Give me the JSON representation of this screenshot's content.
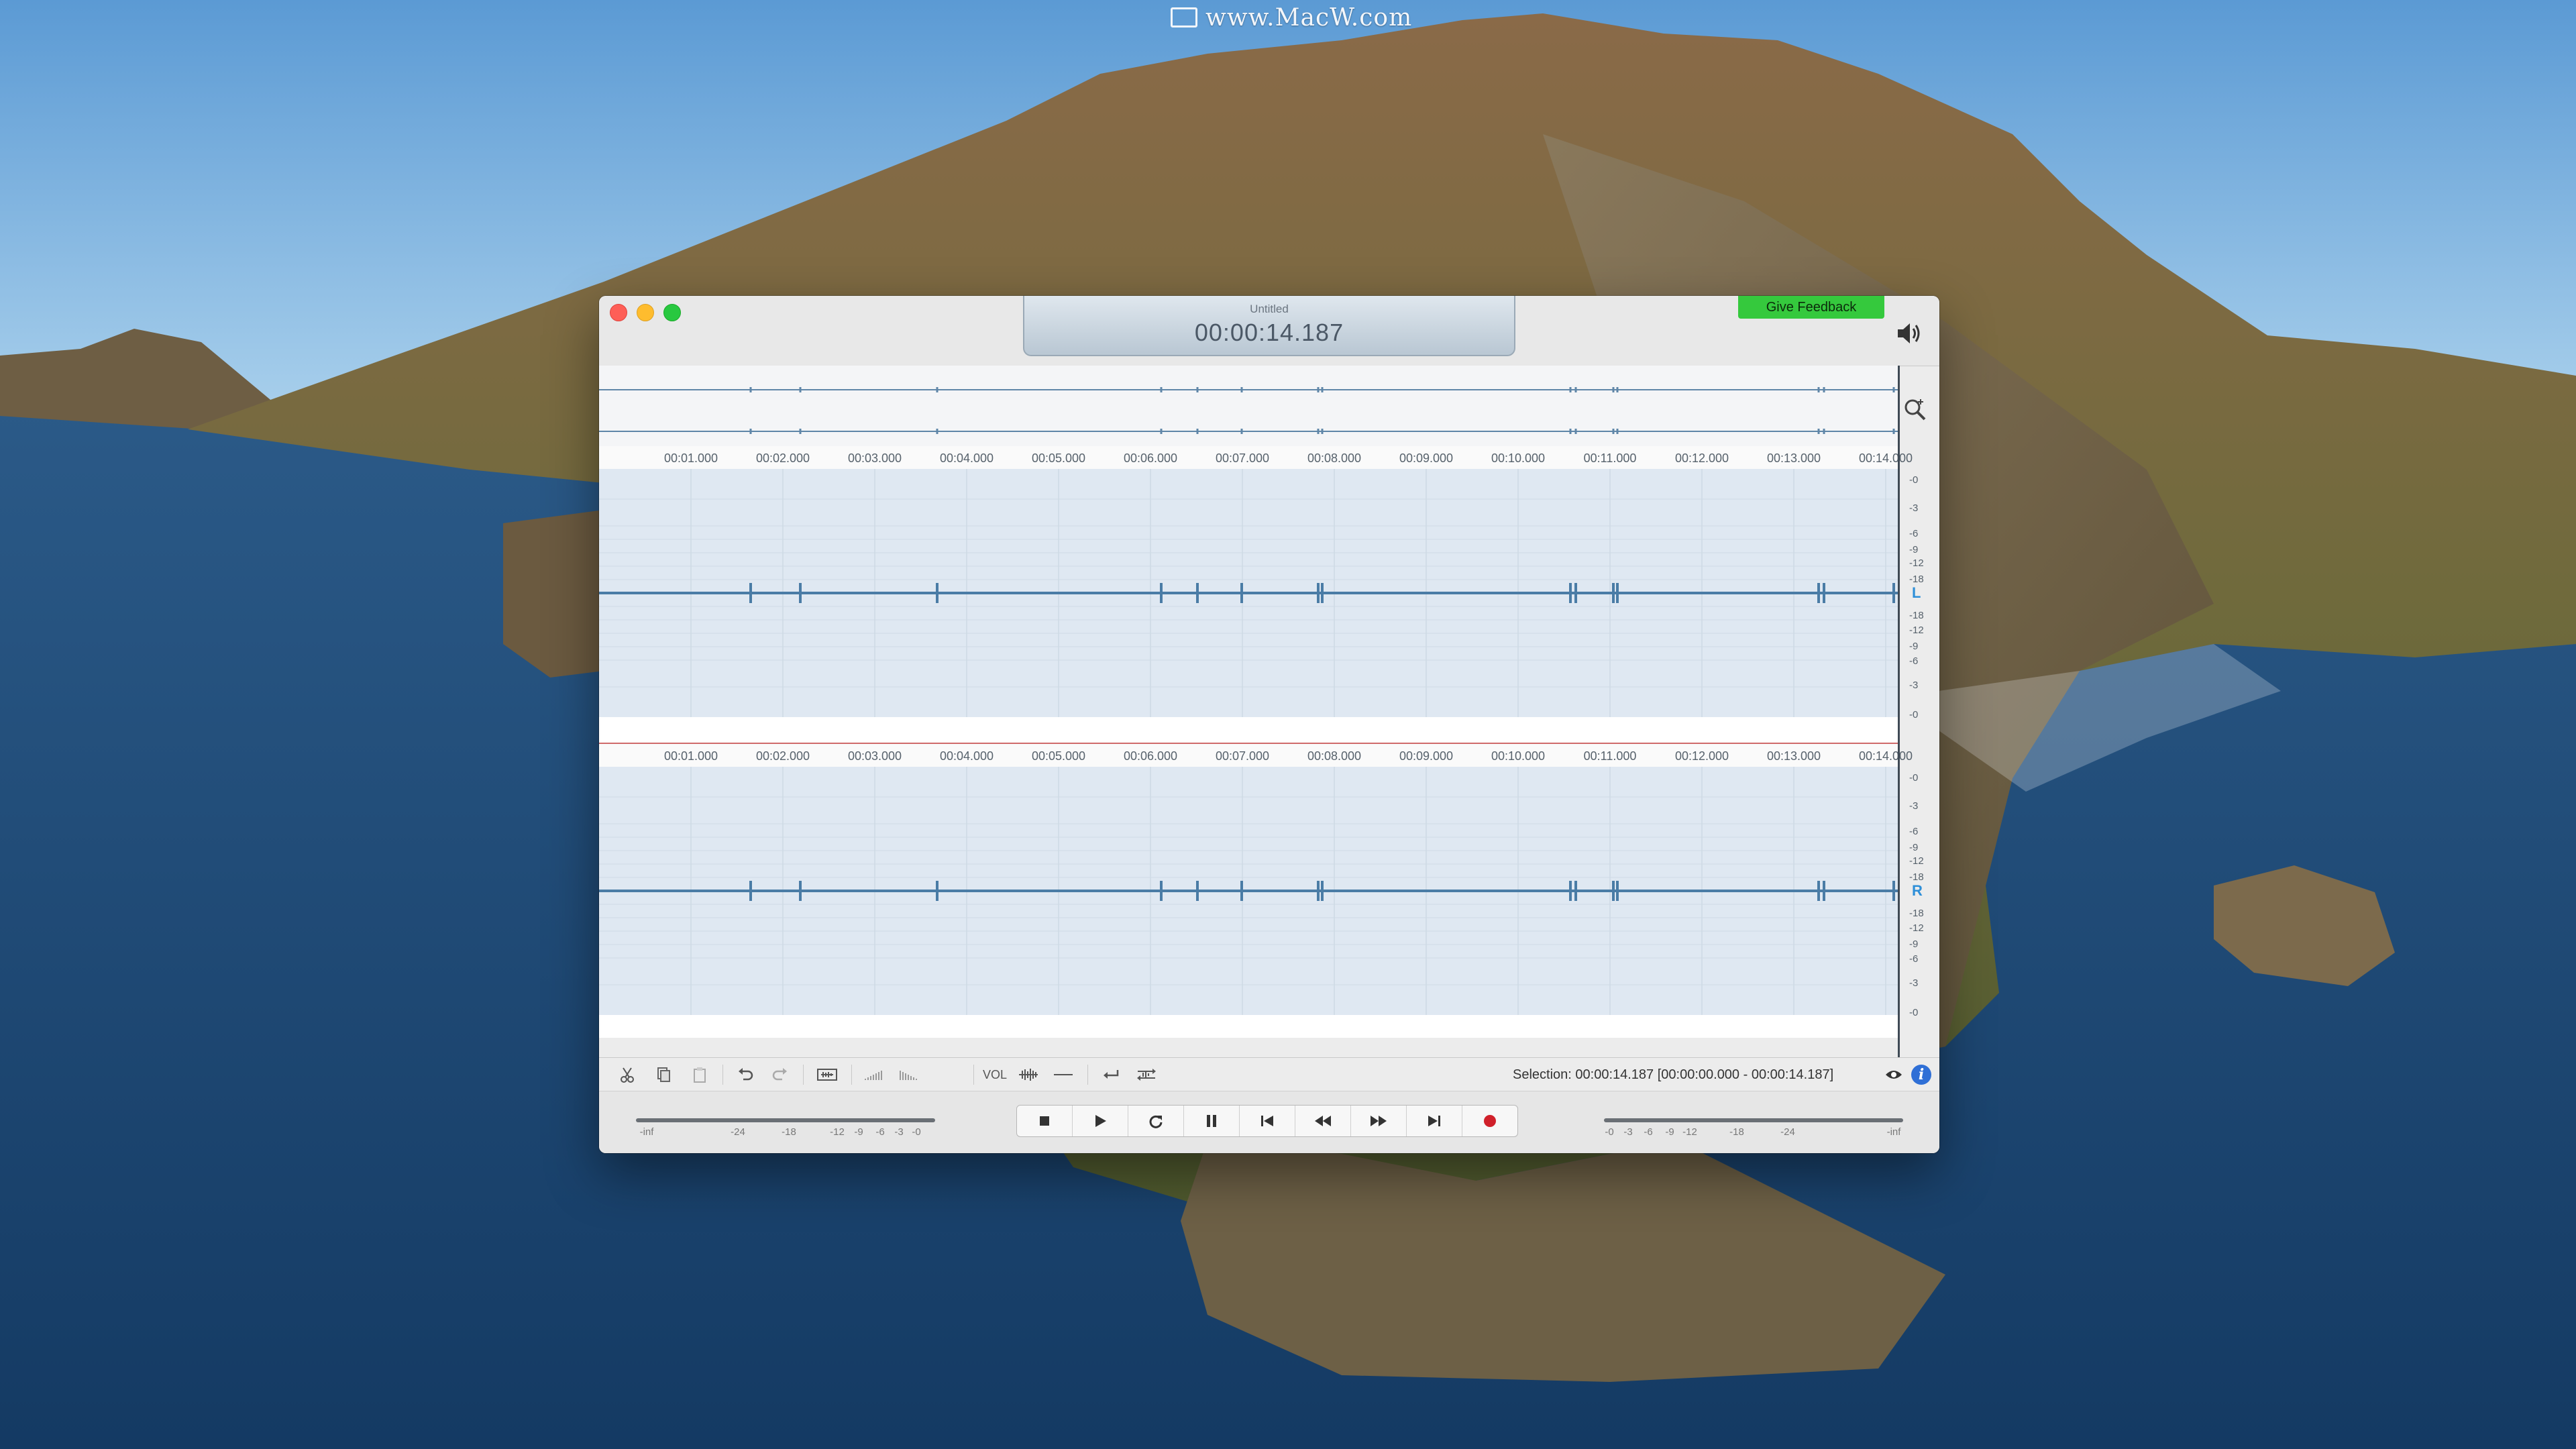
{
  "watermark": "www.MacW.com",
  "window": {
    "document_title": "Untitled",
    "time_display": "00:00:14.187",
    "feedback_button": "Give Feedback"
  },
  "ruler": {
    "labels": [
      "00:01.000",
      "00:02.000",
      "00:03.000",
      "00:04.000",
      "00:05.000",
      "00:06.000",
      "00:07.000",
      "00:08.000",
      "00:09.000",
      "00:10.000",
      "00:11.000",
      "00:12.000",
      "00:13.000",
      "00:14.000"
    ]
  },
  "channels": {
    "left": {
      "label": "L",
      "db_scale": [
        "-0",
        "-3",
        "-6",
        "-9",
        "-12",
        "-18",
        "-18",
        "-12",
        "-9",
        "-6",
        "-3",
        "-0"
      ]
    },
    "right": {
      "label": "R",
      "db_scale": [
        "-0",
        "-3",
        "-6",
        "-9",
        "-12",
        "-18",
        "-18",
        "-12",
        "-9",
        "-6",
        "-3",
        "-0"
      ]
    }
  },
  "toolbar": {
    "vol_label": "VOL",
    "selection_text": "Selection: 00:00:14.187 [00:00:00.000 - 00:00:14.187]"
  },
  "meters": {
    "input_labels": [
      "-inf",
      "-24",
      "-18",
      "-12",
      "-9",
      "-6",
      "-3",
      "-0"
    ],
    "output_labels": [
      "-0",
      "-3",
      "-6",
      "-9",
      "-12",
      "-18",
      "-24",
      "-inf"
    ]
  },
  "icons": [
    "cut-icon",
    "copy-icon",
    "paste-icon",
    "undo-icon",
    "redo-icon",
    "trim-icon",
    "fade-in-icon",
    "fade-out-icon",
    "normalize-icon",
    "silence-icon",
    "loop-icon",
    "loop-selection-icon",
    "show-icon",
    "info-icon",
    "stop-icon",
    "play-icon",
    "repeat-icon",
    "pause-icon",
    "skip-start-icon",
    "rewind-icon",
    "fast-forward-icon",
    "skip-end-icon",
    "record-icon",
    "speaker-icon",
    "zoom-icon"
  ],
  "colors": {
    "waveform": "#4a7ca6",
    "record": "#d0202a",
    "feedback": "#35c93d",
    "channel_label": "#2e8fd8"
  }
}
